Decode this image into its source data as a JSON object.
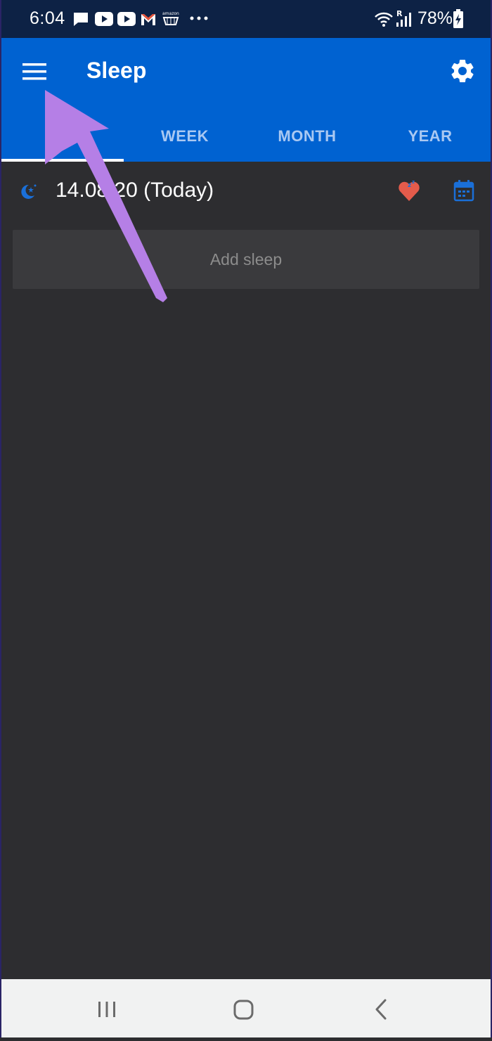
{
  "status_bar": {
    "time": "6:04",
    "battery": "78%",
    "icons": [
      "message-icon",
      "youtube-icon",
      "youtube-icon",
      "gmail-icon",
      "amazon-icon",
      "more-dots-icon",
      "wifi-icon",
      "signal-icon",
      "battery-icon"
    ]
  },
  "app_bar": {
    "title": "Sleep",
    "menu_icon": "hamburger-menu-icon",
    "settings_icon": "gear-icon"
  },
  "tabs": [
    {
      "label": "",
      "selected": true
    },
    {
      "label": "WEEK",
      "selected": false
    },
    {
      "label": "MONTH",
      "selected": false
    },
    {
      "label": "YEAR",
      "selected": false
    }
  ],
  "date_row": {
    "text": "14.08.20 (Today)",
    "left_icon": "moon-stars-icon",
    "right_icons": [
      "sleep-tracker-icon",
      "calendar-icon"
    ]
  },
  "add_sleep_label": "Add sleep",
  "colors": {
    "status_bar": "#0d2245",
    "app_bar": "#0062d1",
    "background": "#2d2d30",
    "card": "#3a3a3d",
    "tab_text": "#a9c8f2",
    "arrow": "#b57fe6",
    "nav_bar": "#f1f2f2"
  },
  "nav_bar": {
    "icons": [
      "recent-apps-icon",
      "home-icon",
      "back-icon"
    ]
  }
}
